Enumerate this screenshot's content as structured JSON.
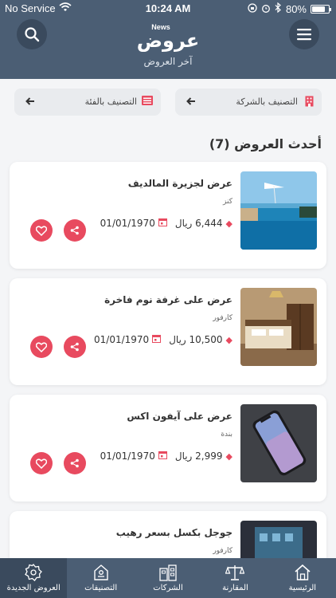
{
  "status": {
    "carrier": "No Service",
    "time": "10:24 AM",
    "battery": "80%",
    "battery_level": 0.8
  },
  "header": {
    "news_label": "News",
    "brand": "عروض",
    "subtitle": "آخر العروض"
  },
  "filters": {
    "company": "التصنيف بالشركة",
    "category": "التصنيف بالفئة"
  },
  "section": {
    "title": "أحدث العروض (7)"
  },
  "offers": [
    {
      "title": "عرض لجزيرة المالديف",
      "company": "كنز",
      "price": "6,444 ريال",
      "date": "01/01/1970"
    },
    {
      "title": "عرض على غرفة نوم فاخرة",
      "company": "كارفور",
      "price": "10,500 ريال",
      "date": "01/01/1970"
    },
    {
      "title": "عرض على آيفون اكس",
      "company": "بندة",
      "price": "2,999 ريال",
      "date": "01/01/1970"
    },
    {
      "title": "جوجل بكسل بسعر رهيب",
      "company": "كارفور",
      "price": "",
      "date": ""
    }
  ],
  "nav": [
    {
      "label": "العروض الجديدة",
      "icon": "badge-icon",
      "active": true
    },
    {
      "label": "التصنيفات",
      "icon": "tag-icon"
    },
    {
      "label": "الشركات",
      "icon": "buildings-icon"
    },
    {
      "label": "المقارنة",
      "icon": "scale-icon"
    },
    {
      "label": "الرئيسية",
      "icon": "home-icon"
    }
  ],
  "colors": {
    "header": "#4b5e74",
    "accent": "#e84a5f",
    "background": "#f4f5f7"
  }
}
